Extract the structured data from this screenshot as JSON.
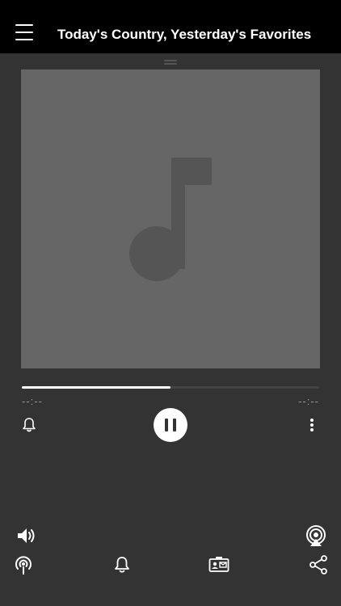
{
  "header": {
    "title": "Today's Country, Yesterday's Favorites",
    "menu_icon": "hamburger-menu-icon"
  },
  "artwork": {
    "icon": "music-note-icon"
  },
  "player": {
    "progress": 0.5,
    "time_elapsed": "--:--",
    "time_remaining": "--:--",
    "state": "playing",
    "play_pause_icon": "pause-icon",
    "left_icon": "bell-icon",
    "right_icon": "more-vertical-icon"
  },
  "bottom_bar": {
    "top_row": [
      "volume-icon",
      "airplay-icon"
    ],
    "bottom_row": [
      "podcast-icon",
      "bell-icon",
      "contact-card-icon",
      "share-icon"
    ]
  },
  "colors": {
    "background": "#333333",
    "header": "#000000",
    "artwork": "#666666",
    "accent": "#ffffff"
  }
}
